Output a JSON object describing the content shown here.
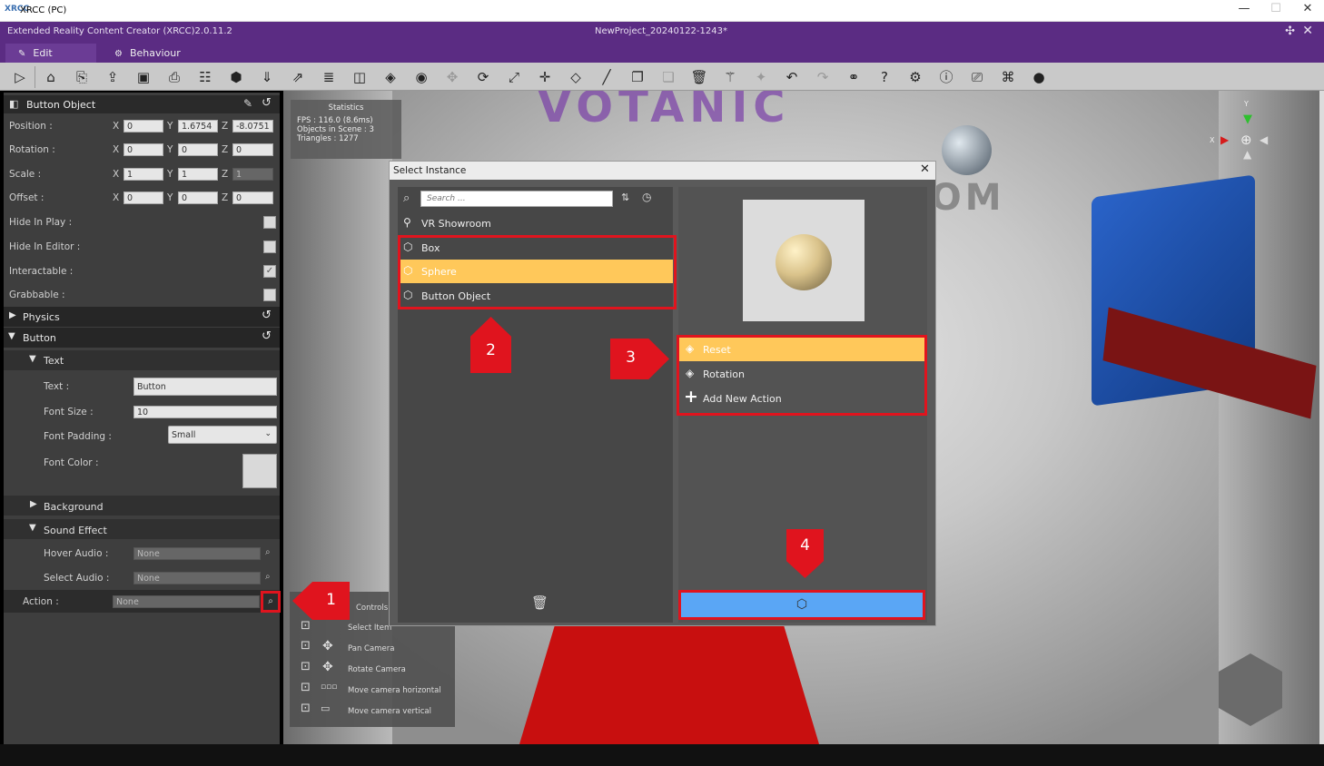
{
  "window": {
    "app_icon": "XRCC",
    "title": "XRCC (PC)",
    "min": "—",
    "max": "☐",
    "close": "✕"
  },
  "appbar": {
    "product": "Extended Reality Content Creator (XRCC)2.0.11.2",
    "project": "NewProject_20240122-1243*"
  },
  "tabs": [
    {
      "label": "Edit"
    },
    {
      "label": "Behaviour"
    }
  ],
  "inspector": {
    "title": "Button Object",
    "position_label": "Position :",
    "rotation_label": "Rotation :",
    "scale_label": "Scale :",
    "offset_label": "Offset :",
    "axes": {
      "x": "X",
      "y": "Y",
      "z": "Z"
    },
    "position": {
      "x": "0",
      "y": "1.6754",
      "z": "-8.0751"
    },
    "rotation": {
      "x": "0",
      "y": "0",
      "z": "0"
    },
    "scale": {
      "x": "1",
      "y": "1",
      "z": "1"
    },
    "offset": {
      "x": "0",
      "y": "0",
      "z": "0"
    },
    "hide_in_play_label": "Hide In Play :",
    "hide_in_editor_label": "Hide In Editor :",
    "interactable_label": "Interactable :",
    "grabbable_label": "Grabbable :",
    "physics_label": "Physics",
    "button_label": "Button",
    "text_section_label": "Text",
    "text_label": "Text :",
    "text_value": "Button",
    "font_size_label": "Font Size :",
    "font_size_value": "10",
    "font_padding_label": "Font Padding :",
    "font_padding_value": "Small",
    "font_color_label": "Font Color :",
    "background_label": "Background",
    "sound_effect_label": "Sound Effect",
    "hover_audio_label": "Hover Audio :",
    "hover_audio_value": "None",
    "select_audio_label": "Select Audio :",
    "select_audio_value": "None",
    "action_label": "Action :",
    "action_value": "None"
  },
  "stats": {
    "title": "Statistics",
    "fps": "FPS : 116.0 (8.6ms)",
    "objects": "Objects in Scene : 3",
    "triangles": "Triangles : 1277"
  },
  "controls": {
    "title": "Controls",
    "select_item": "Select Item",
    "pan": "Pan Camera",
    "rotate": "Rotate Camera",
    "move_h": "Move camera horizontal",
    "move_v": "Move camera vertical"
  },
  "scene": {
    "sign": "VOTANIC",
    "sign2": "ROOM",
    "gizmo_x": "X",
    "gizmo_y": "Y"
  },
  "dialog": {
    "title": "Select Instance",
    "close": "✕",
    "search_placeholder": "Search ...",
    "instances": [
      {
        "label": "VR Showroom",
        "icon": "pin-icon",
        "selected": false
      },
      {
        "label": "Box",
        "icon": "cube-icon",
        "selected": false
      },
      {
        "label": "Sphere",
        "icon": "cube-icon",
        "selected": true
      },
      {
        "label": "Button Object",
        "icon": "cube-icon",
        "selected": false
      }
    ],
    "actions": [
      {
        "label": "Reset",
        "icon": "layers-icon",
        "selected": true
      },
      {
        "label": "Rotation",
        "icon": "layers-icon",
        "selected": false
      },
      {
        "label": "Add New Action",
        "icon": "plus-icon",
        "selected": false
      }
    ]
  },
  "annotations": {
    "m1": "1",
    "m2": "2",
    "m3": "3",
    "m4": "4"
  },
  "colors": {
    "accent_purple": "#5b2c83",
    "highlight_yellow": "#ffc85a",
    "confirm_blue": "#5aa6f5",
    "annotation_red": "#e0141e"
  }
}
